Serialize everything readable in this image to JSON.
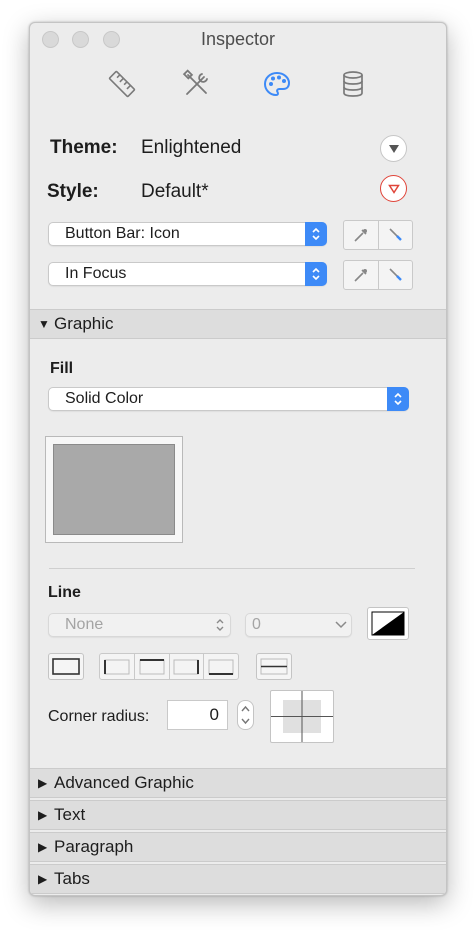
{
  "window": {
    "title": "Inspector"
  },
  "toolbar": {
    "tabs": [
      {
        "icon": "ruler-icon"
      },
      {
        "icon": "tools-icon"
      },
      {
        "icon": "palette-icon",
        "selected": true
      },
      {
        "icon": "database-icon"
      }
    ]
  },
  "theme": {
    "label": "Theme:",
    "value": "Enlightened"
  },
  "style": {
    "label": "Style:",
    "value": "Default*"
  },
  "selectors": {
    "element": "Button Bar: Icon",
    "state": "In Focus"
  },
  "sections": {
    "graphic": "Graphic",
    "advanced_graphic": "Advanced Graphic",
    "text": "Text",
    "paragraph": "Paragraph",
    "tabs": "Tabs"
  },
  "fill": {
    "label": "Fill",
    "type": "Solid Color",
    "color": "#a9a9a9"
  },
  "line": {
    "label": "Line",
    "style": "None",
    "width": "0"
  },
  "corner": {
    "label": "Corner radius:",
    "value": "0"
  },
  "colors": {
    "accent": "#3d8af7",
    "alert": "#e0453a",
    "panel": "#ececec"
  }
}
